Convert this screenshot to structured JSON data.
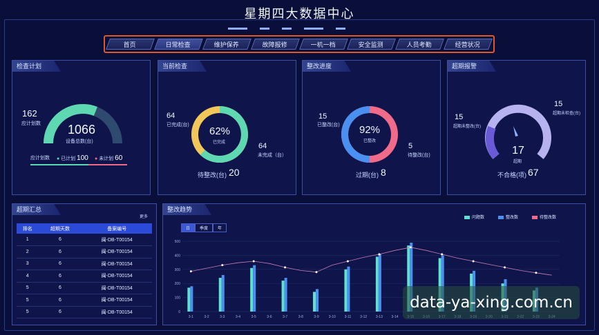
{
  "title": "星期四大数据中心",
  "nav": [
    "首页",
    "日常检查",
    "维护保养",
    "故障报修",
    "一机一档",
    "安全监测",
    "人员考勤",
    "经营状况"
  ],
  "nav_active": 1,
  "panels": {
    "plan": {
      "title": "检查计划",
      "total_value": "162",
      "total_label": "应计划数",
      "center_value": "1066",
      "center_label": "设备总数(台)",
      "legend_title": "应计划数",
      "planned_label": "已计划",
      "planned_value": "100",
      "unplanned_label": "未计划",
      "unplanned_value": "60",
      "gauge_fraction": 0.62
    },
    "current": {
      "title": "当前检查",
      "done_value": "64",
      "done_label": "已完成(台)",
      "center_pct": "62%",
      "center_label": "已完成",
      "undone_value": "64",
      "undone_label": "未完成（台）",
      "pending_label": "待整改(台)",
      "pending_value": "20",
      "fraction": 0.62
    },
    "progress": {
      "title": "整改进度",
      "done_value": "15",
      "done_label": "已整改(台)",
      "center_pct": "92%",
      "center_label": "已整改",
      "pending_value": "5",
      "pending_label": "待整改(台)",
      "overdue_label": "过期(台)",
      "overdue_value": "8",
      "fraction": 0.5
    },
    "alarm": {
      "title": "超期报警",
      "left_value": "15",
      "left_label": "超期未整改(台)",
      "right_value": "15",
      "right_label": "超期未检查(台)",
      "center_value": "17",
      "center_label": "超期",
      "fail_label": "不合格(项)",
      "fail_value": "67"
    },
    "summary": {
      "title": "超期汇总",
      "more": "更多",
      "columns": [
        "排名",
        "超期天数",
        "备案编号"
      ],
      "rows": [
        [
          "1",
          "6",
          "闽-DB-T00154"
        ],
        [
          "2",
          "6",
          "闽-DB-T00154"
        ],
        [
          "3",
          "6",
          "闽-DB-T00154"
        ],
        [
          "4",
          "6",
          "闽-DB-T00154"
        ],
        [
          "5",
          "6",
          "闽-DB-T00154"
        ],
        [
          "5",
          "6",
          "闽-DB-T00154"
        ],
        [
          "5",
          "6",
          "闽-DB-T00154"
        ]
      ]
    },
    "trend": {
      "title": "整改趋势",
      "tabs": [
        "日",
        "季度",
        "年"
      ],
      "legend": [
        {
          "name": "问题数",
          "color": "#5fe0d0"
        },
        {
          "name": "整改数",
          "color": "#4a90f0"
        },
        {
          "name": "待整改数",
          "color": "#f06a8a"
        }
      ]
    }
  },
  "chart_data": {
    "type": "bar",
    "categories": [
      "3-1",
      "3-2",
      "3-3",
      "3-4",
      "3-5",
      "3-6",
      "3-7",
      "3-8",
      "3-9",
      "3-10",
      "3-11",
      "3-12",
      "3-13",
      "3-14",
      "3-15",
      "3-16",
      "3-17",
      "3-18",
      "3-19",
      "3-20",
      "3-21",
      "3-22",
      "3-23",
      "3-24"
    ],
    "yticks": [
      "500",
      "400",
      "300",
      "200",
      "100",
      "0"
    ],
    "ylim": [
      0,
      500
    ],
    "series": [
      {
        "name": "问题数",
        "values": [
          170,
          0,
          240,
          0,
          310,
          0,
          220,
          0,
          140,
          0,
          300,
          0,
          390,
          0,
          470,
          0,
          380,
          0,
          270,
          0,
          200,
          0,
          150,
          0
        ]
      },
      {
        "name": "整改数",
        "values": [
          180,
          0,
          260,
          0,
          330,
          0,
          240,
          0,
          160,
          0,
          320,
          0,
          410,
          0,
          490,
          0,
          400,
          0,
          290,
          0,
          230,
          0,
          170,
          0
        ]
      },
      {
        "name": "待整改数",
        "values": [
          250,
          290,
          330,
          360,
          380,
          350,
          300,
          260,
          240,
          330,
          380,
          430,
          470,
          520,
          560,
          520,
          470,
          420,
          380,
          340,
          300,
          260,
          230,
          200
        ]
      }
    ]
  },
  "watermark": "data-ya-xing.com.cn"
}
